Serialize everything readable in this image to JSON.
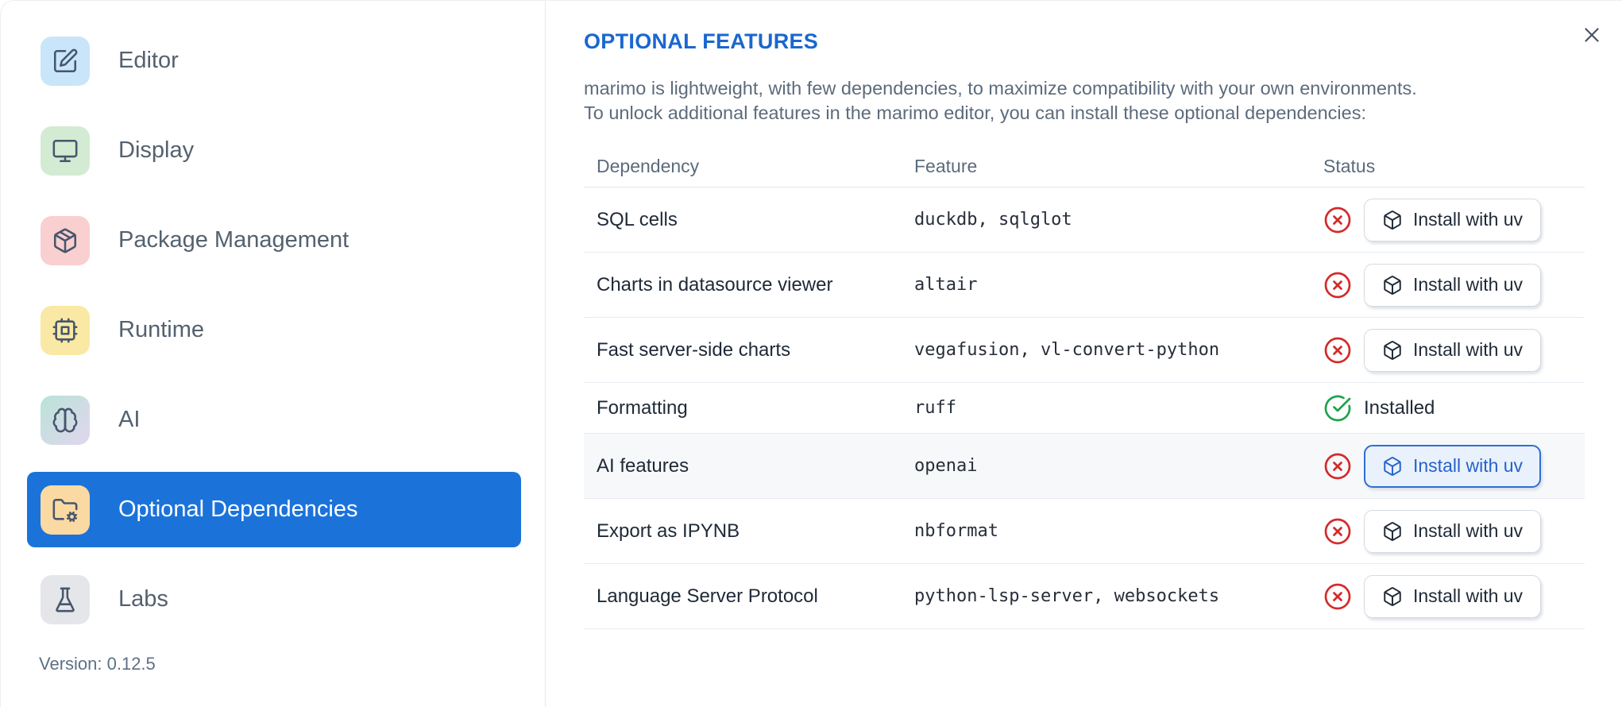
{
  "colors": {
    "title_blue": "#1a67cf",
    "selected_item_blue": "#1b73da",
    "focused_button_blue": "#2e6fd2",
    "missing_red": "#d32b2b",
    "installed_green": "#1fa24a"
  },
  "sidebar": {
    "items": [
      {
        "label": "Editor",
        "icon": "square-pen",
        "icon_bg": "#c9e5f9"
      },
      {
        "label": "Display",
        "icon": "monitor",
        "icon_bg": "#d3ebd3"
      },
      {
        "label": "Package Management",
        "icon": "package",
        "icon_bg": "#f9cfcf"
      },
      {
        "label": "Runtime",
        "icon": "cpu",
        "icon_bg": "#fae9a4"
      },
      {
        "label": "AI",
        "icon": "brain",
        "icon_bg": "#b9e3d8",
        "icon_bg2": "#e2d6ee"
      },
      {
        "label": "Optional Dependencies",
        "icon": "folder-cog",
        "icon_bg": "#fbd9a2",
        "selected": true
      },
      {
        "label": "Labs",
        "icon": "flask",
        "icon_bg": "#e4e6e9"
      }
    ],
    "version_label": "Version: 0.12.5"
  },
  "main": {
    "title": "OPTIONAL FEATURES",
    "description_lines": [
      "marimo is lightweight, with few dependencies, to maximize compatibility with your own environments.",
      "To unlock additional features in the marimo editor, you can install these optional dependencies:"
    ],
    "table": {
      "columns": [
        "Dependency",
        "Feature",
        "Status"
      ],
      "install_button_label": "Install with uv",
      "installed_label": "Installed",
      "rows": [
        {
          "dependency": "SQL cells",
          "feature": "duckdb, sqlglot",
          "status": "missing"
        },
        {
          "dependency": "Charts in datasource viewer",
          "feature": "altair",
          "status": "missing"
        },
        {
          "dependency": "Fast server-side charts",
          "feature": "vegafusion, vl-convert-python",
          "status": "missing"
        },
        {
          "dependency": "Formatting",
          "feature": "ruff",
          "status": "installed"
        },
        {
          "dependency": "AI features",
          "feature": "openai",
          "status": "missing",
          "highlighted": true
        },
        {
          "dependency": "Export as IPYNB",
          "feature": "nbformat",
          "status": "missing"
        },
        {
          "dependency": "Language Server Protocol",
          "feature": "python-lsp-server, websockets",
          "status": "missing"
        }
      ]
    }
  }
}
